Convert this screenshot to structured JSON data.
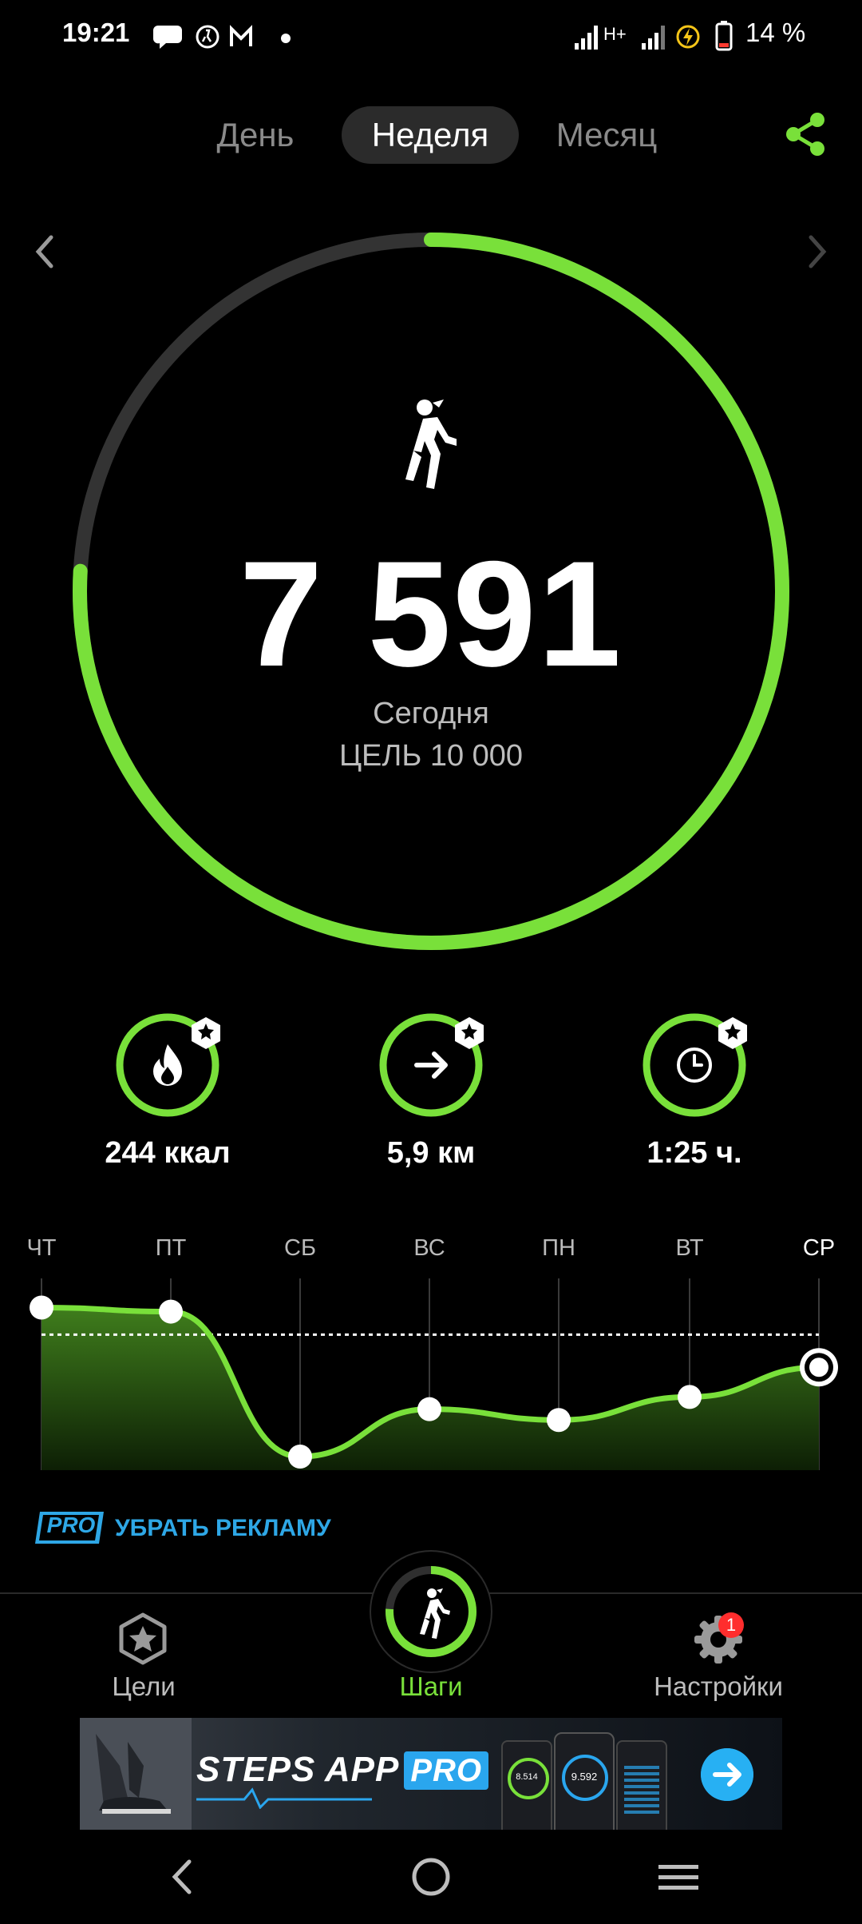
{
  "status": {
    "time": "19:21",
    "battery": "14 %",
    "network": "H+",
    "icons": [
      "chat-icon",
      "steps-app-icon",
      "gmail-icon",
      "dot-icon",
      "signal-icon",
      "signal-icon",
      "battery-saver-icon",
      "battery-icon"
    ]
  },
  "tabs": [
    {
      "label": "День",
      "selected": false
    },
    {
      "label": "Неделя",
      "selected": true
    },
    {
      "label": "Месяц",
      "selected": false
    }
  ],
  "summary": {
    "steps": "7 591",
    "period": "Сегодня",
    "goal": "ЦЕЛЬ 10 000",
    "progress": 0.7591
  },
  "metrics": [
    {
      "icon": "flame-icon",
      "value": "244 ккал"
    },
    {
      "icon": "arrow-right-icon",
      "value": "5,9 км"
    },
    {
      "icon": "clock-icon",
      "value": "1:25 ч."
    }
  ],
  "chart_data": {
    "type": "area",
    "categories": [
      "ЧТ",
      "ПТ",
      "СБ",
      "ВС",
      "ПН",
      "ВТ",
      "СР"
    ],
    "series": [
      {
        "values": [
          12000,
          11700,
          1000,
          4500,
          3700,
          5400,
          7591
        ]
      }
    ],
    "goal_line": 10000,
    "ylim": [
      0,
      12500
    ],
    "selected_category": "СР",
    "grid": true
  },
  "pro": {
    "badge": "PRO",
    "text": "УБРАТЬ РЕКЛАМУ"
  },
  "bottom_nav": {
    "goals": "Цели",
    "steps": "Шаги",
    "settings": "Настройки",
    "settings_badge": "1"
  },
  "ad": {
    "brand": "STEPS APP",
    "brand_pro": "PRO",
    "phone_values": [
      "8.514",
      "9.592"
    ]
  },
  "colors": {
    "accent": "#79e03a",
    "ring_track": "#333333",
    "link": "#2ea7e6",
    "badge": "#ff2d2d"
  }
}
